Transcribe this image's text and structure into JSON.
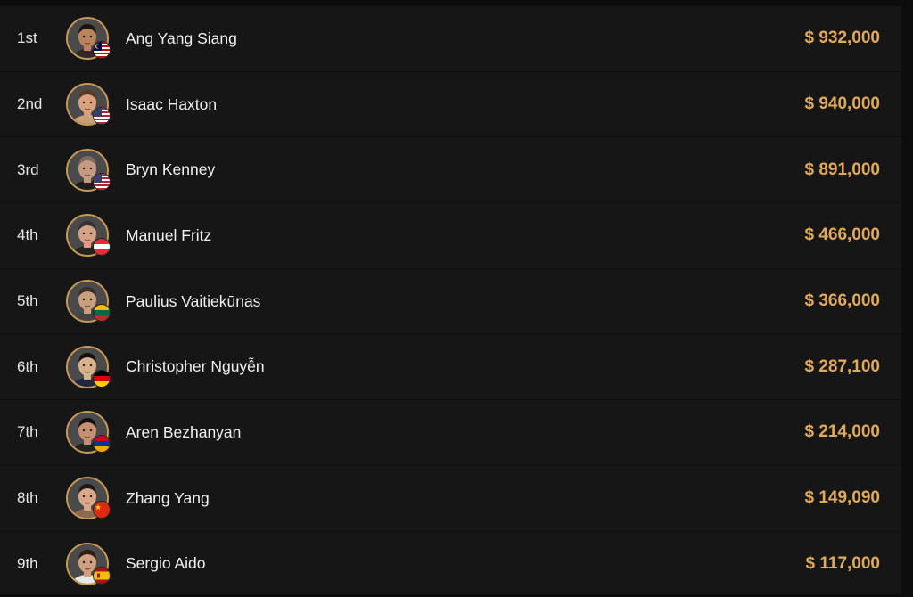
{
  "colors": {
    "background": "#161616",
    "accent": "#e0a95c",
    "avatar_ring": "#c89a55",
    "text": "#f0f0f0"
  },
  "rows": [
    {
      "rank": "1st",
      "name": "Ang Yang Siang",
      "prize": "$ 932,000",
      "flag_icon": "malaysia-flag-icon",
      "skin": "#b9845c",
      "hair": "#1c1410",
      "shirt": "#2a2a2a"
    },
    {
      "rank": "2nd",
      "name": "Isaac Haxton",
      "prize": "$ 940,000",
      "flag_icon": "usa-flag-icon",
      "skin": "#d9a27e",
      "hair": "#5a3a22",
      "shirt": "#c9a07c"
    },
    {
      "rank": "3rd",
      "name": "Bryn Kenney",
      "prize": "$ 891,000",
      "flag_icon": "usa-flag-icon",
      "skin": "#c69a80",
      "hair": "#7a6a60",
      "shirt": "#1d1d1d"
    },
    {
      "rank": "4th",
      "name": "Manuel Fritz",
      "prize": "$ 466,000",
      "flag_icon": "austria-flag-icon",
      "skin": "#d3a184",
      "hair": "#333333",
      "shirt": "#222222"
    },
    {
      "rank": "5th",
      "name": "Paulius Vaitiekūnas",
      "prize": "$ 366,000",
      "flag_icon": "lithuania-flag-icon",
      "skin": "#c9a07e",
      "hair": "#3b2e24",
      "shirt": "#444444"
    },
    {
      "rank": "6th",
      "name": "Christopher Nguyễn",
      "prize": "$ 287,100",
      "flag_icon": "germany-flag-icon",
      "skin": "#d8b08e",
      "hair": "#111111",
      "shirt": "#1b2a44"
    },
    {
      "rank": "7th",
      "name": "Aren Bezhanyan",
      "prize": "$ 214,000",
      "flag_icon": "armenia-flag-icon",
      "skin": "#c49070",
      "hair": "#151010",
      "shirt": "#222222"
    },
    {
      "rank": "8th",
      "name": "Zhang Yang",
      "prize": "$ 149,090",
      "flag_icon": "china-flag-icon",
      "skin": "#d9a889",
      "hair": "#1a1a1a",
      "shirt": "#8a6a50"
    },
    {
      "rank": "9th",
      "name": "Sergio Aido",
      "prize": "$ 117,000",
      "flag_icon": "spain-flag-icon",
      "skin": "#d0a080",
      "hair": "#2a1d14",
      "shirt": "#e8e8e8"
    }
  ]
}
